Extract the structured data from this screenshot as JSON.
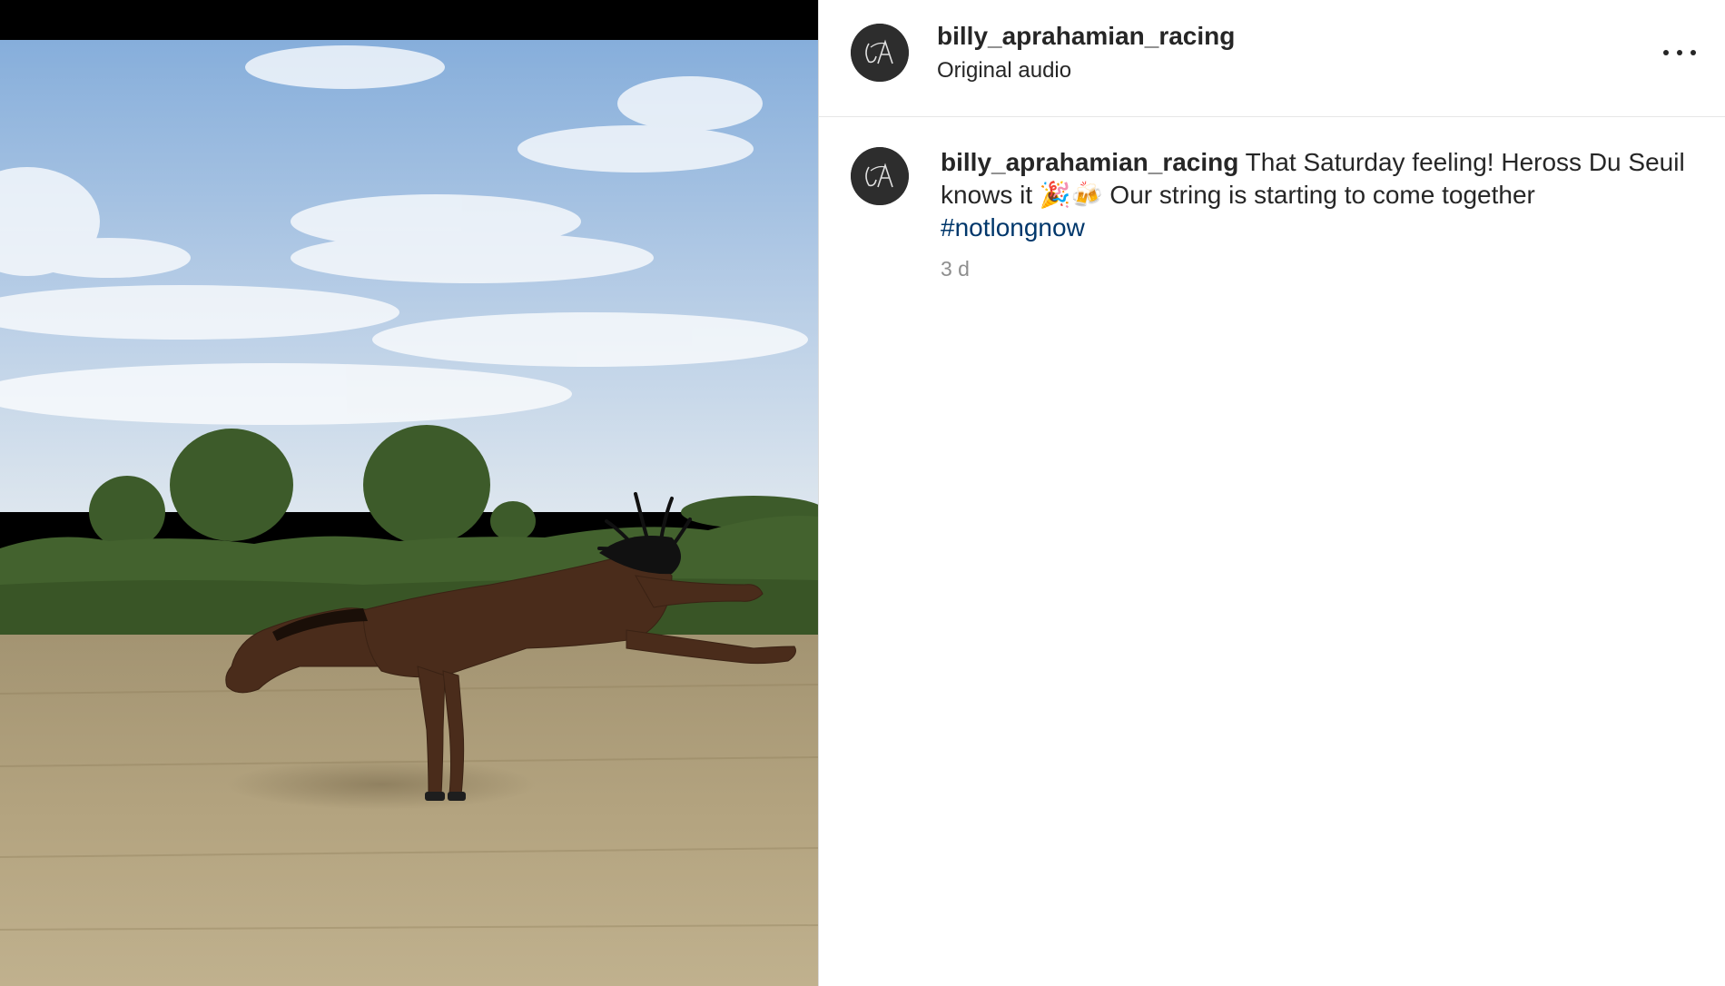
{
  "post": {
    "username": "billy_aprahamian_racing",
    "audio": "Original audio",
    "caption_text": "That Saturday feeling! Heross Du Seuil knows it 🎉🍻 Our string is starting to come together",
    "hashtag": "#notlongnow",
    "time_ago": "3 d",
    "avatar_monogram": "BA"
  },
  "icons": {
    "more": "more-options-icon",
    "avatar": "avatar-monogram-icon"
  },
  "colors": {
    "text": "#262626",
    "secondary": "#8e8e8e",
    "hashtag": "#00376b",
    "divider": "#dbdbdb",
    "avatar_bg": "#2d2d2d"
  }
}
